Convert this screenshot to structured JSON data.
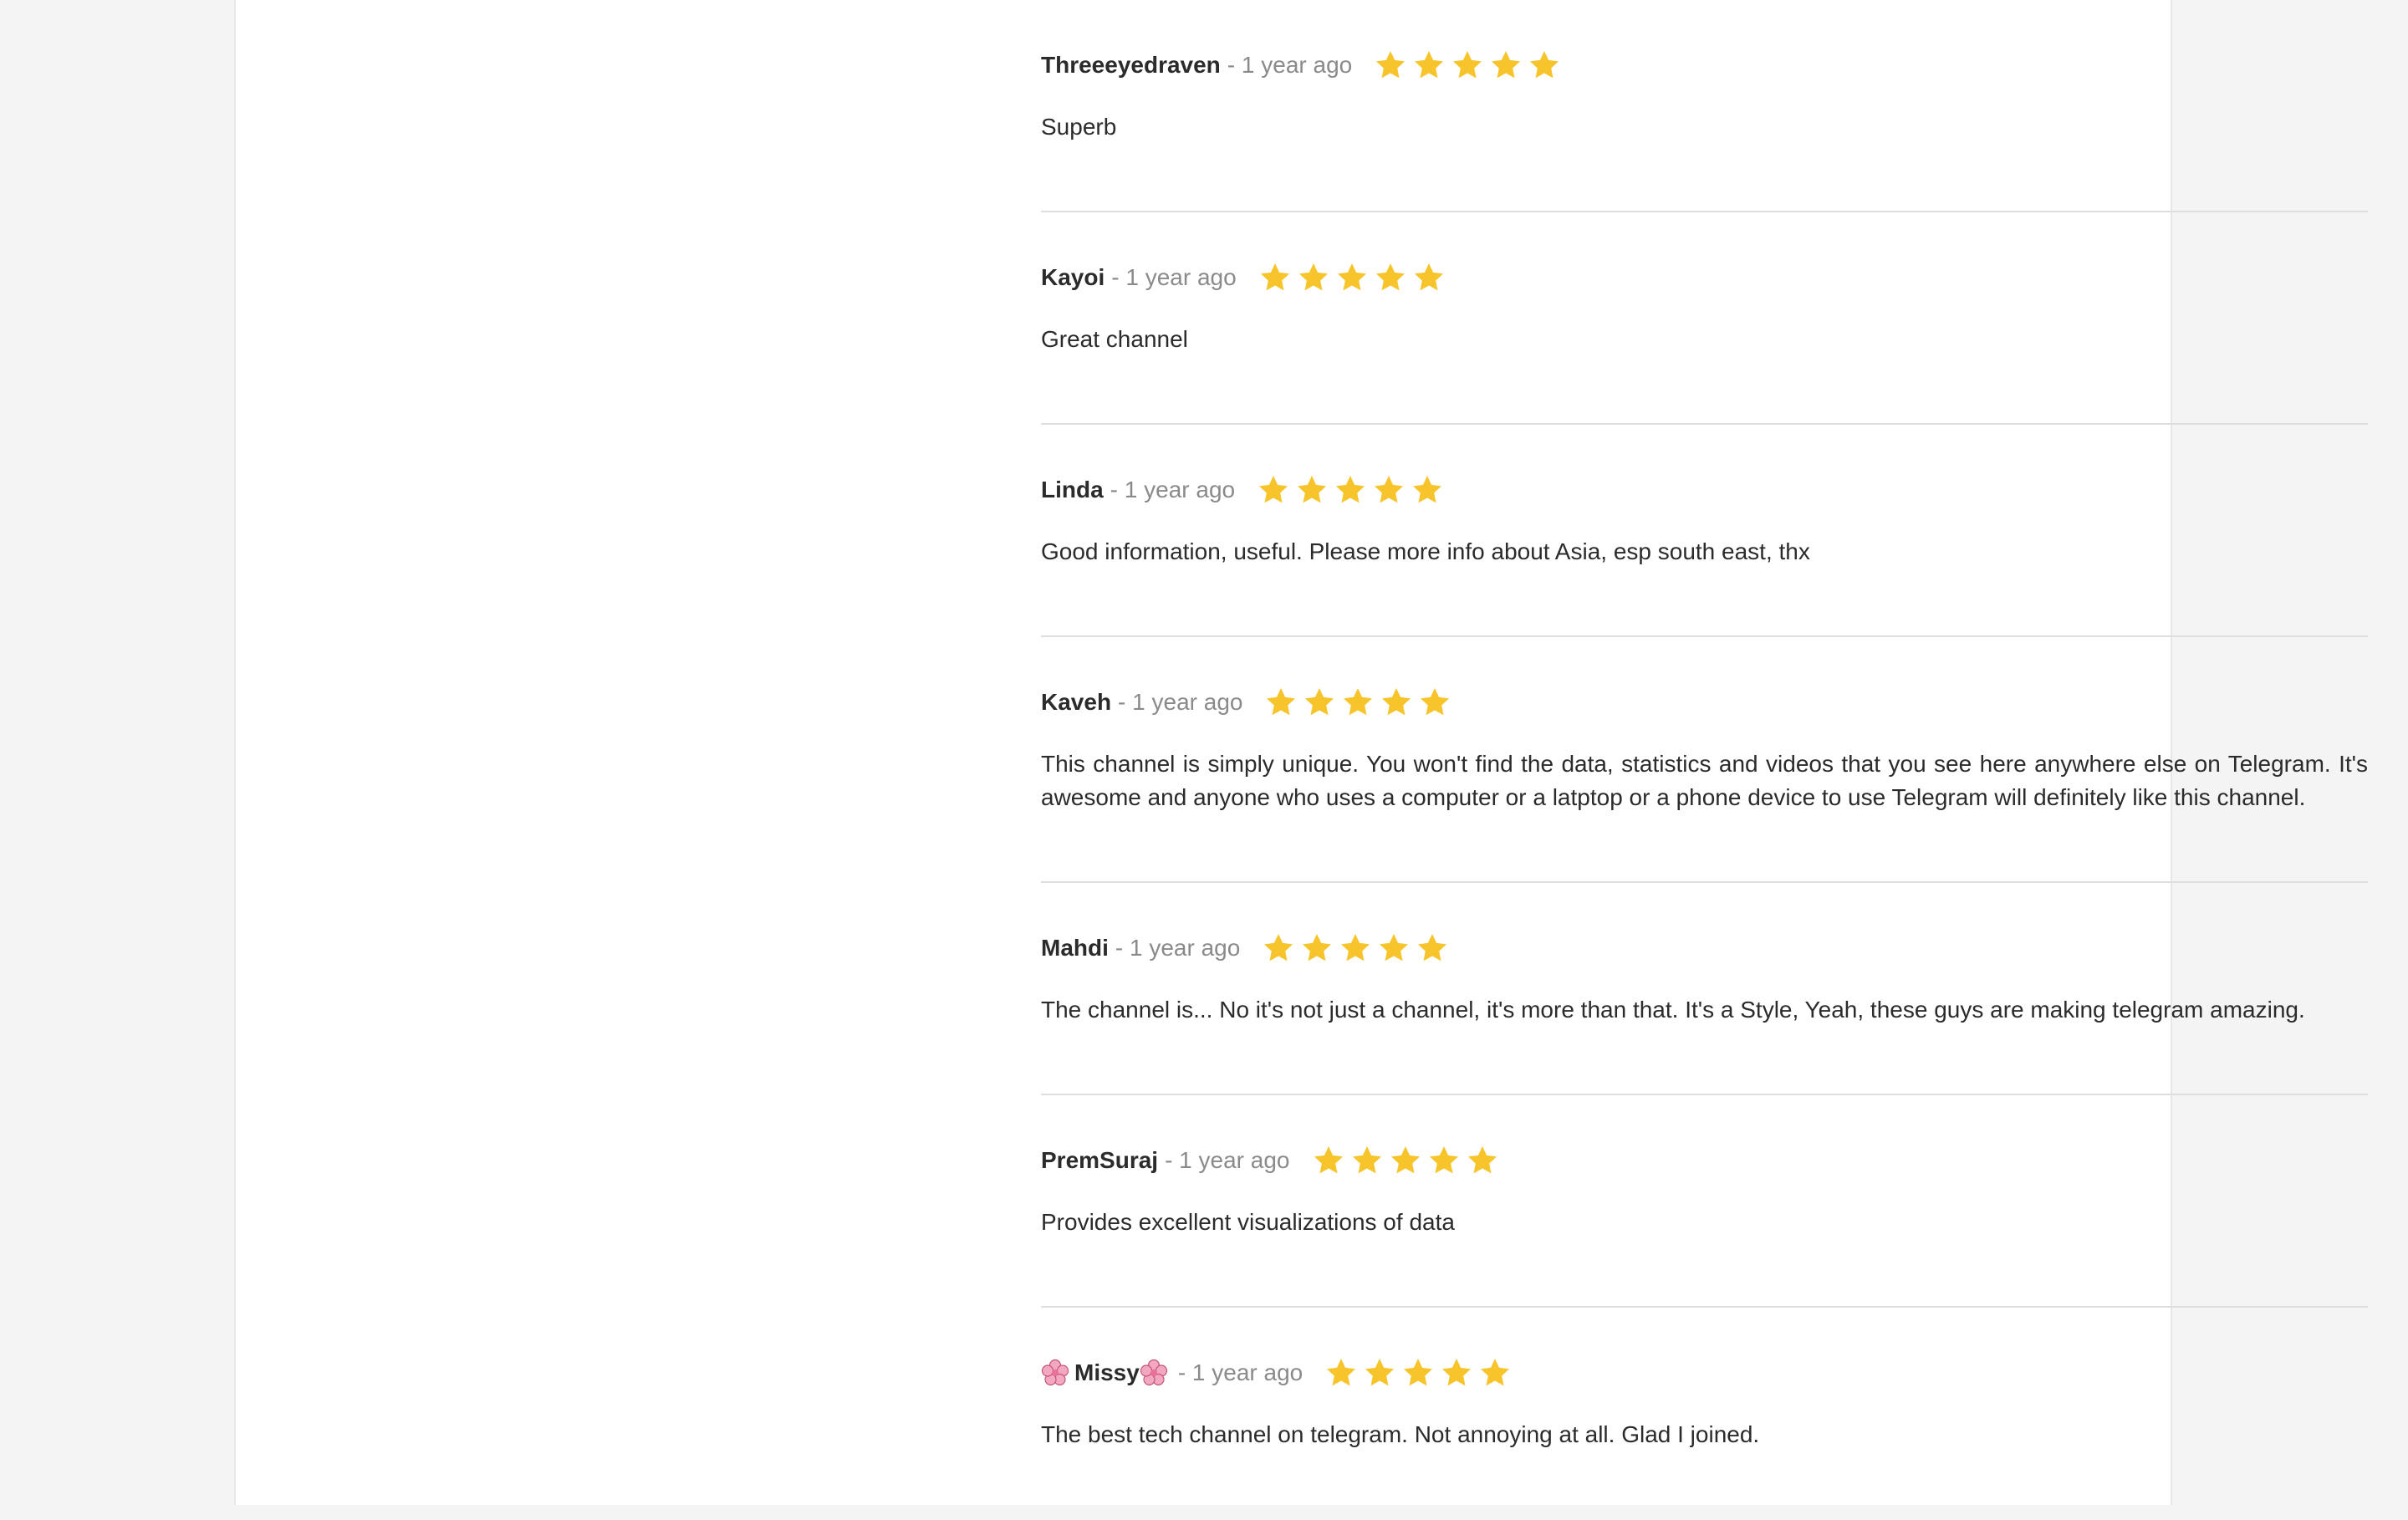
{
  "colors": {
    "star": "#f7c52b",
    "author": "#2b2b2b",
    "time": "#8a8a8a",
    "divider": "#dedede",
    "background": "#f4f4f4"
  },
  "reviews": [
    {
      "author": "Threeeyedraven",
      "time": "- 1 year ago",
      "rating": 5,
      "text": "Superb"
    },
    {
      "author": "Kayoi",
      "time": "- 1 year ago",
      "rating": 5,
      "text": "Great channel"
    },
    {
      "author": "Linda",
      "time": "- 1 year ago",
      "rating": 5,
      "text": "Good information, useful. Please more info about Asia, esp south east, thx"
    },
    {
      "author": "Kaveh",
      "time": "- 1 year ago",
      "rating": 5,
      "text": "This channel is simply unique. You won't find the data, statistics and videos that you see here anywhere else on Telegram. It's awesome and anyone who uses a computer or a latptop or a phone device to use Telegram will definitely like this channel."
    },
    {
      "author": "Mahdi",
      "time": "- 1 year ago",
      "rating": 5,
      "text": "The channel is... No it's not just a channel, it's more than that. It's a Style, Yeah, these guys are making telegram amazing."
    },
    {
      "author": "PremSuraj",
      "time": "- 1 year ago",
      "rating": 5,
      "text": "Provides excellent visualizations of data"
    },
    {
      "author": "Missy",
      "time": "- 1 year ago",
      "rating": 5,
      "text": "The best tech channel on telegram. Not annoying at all. Glad I joined.",
      "author_decoration": "cherry-blossom-icon"
    }
  ]
}
